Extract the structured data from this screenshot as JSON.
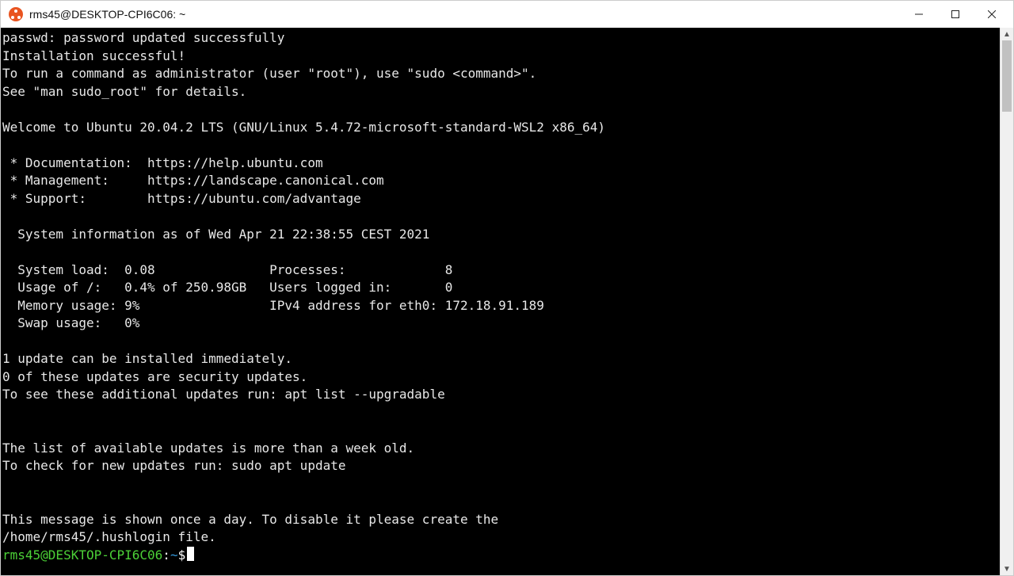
{
  "window": {
    "title": "rms45@DESKTOP-CPI6C06: ~"
  },
  "terminal": {
    "lines": [
      "passwd: password updated successfully",
      "Installation successful!",
      "To run a command as administrator (user \"root\"), use \"sudo <command>\".",
      "See \"man sudo_root\" for details.",
      "",
      "Welcome to Ubuntu 20.04.2 LTS (GNU/Linux 5.4.72-microsoft-standard-WSL2 x86_64)",
      "",
      " * Documentation:  https://help.ubuntu.com",
      " * Management:     https://landscape.canonical.com",
      " * Support:        https://ubuntu.com/advantage",
      "",
      "  System information as of Wed Apr 21 22:38:55 CEST 2021",
      "",
      "  System load:  0.08               Processes:             8",
      "  Usage of /:   0.4% of 250.98GB   Users logged in:       0",
      "  Memory usage: 9%                 IPv4 address for eth0: 172.18.91.189",
      "  Swap usage:   0%",
      "",
      "1 update can be installed immediately.",
      "0 of these updates are security updates.",
      "To see these additional updates run: apt list --upgradable",
      "",
      "",
      "The list of available updates is more than a week old.",
      "To check for new updates run: sudo apt update",
      "",
      "",
      "This message is shown once a day. To disable it please create the",
      "/home/rms45/.hushlogin file."
    ],
    "prompt": {
      "user_host": "rms45@DESKTOP-CPI6C06",
      "separator": ":",
      "path": "~",
      "symbol": "$"
    }
  }
}
